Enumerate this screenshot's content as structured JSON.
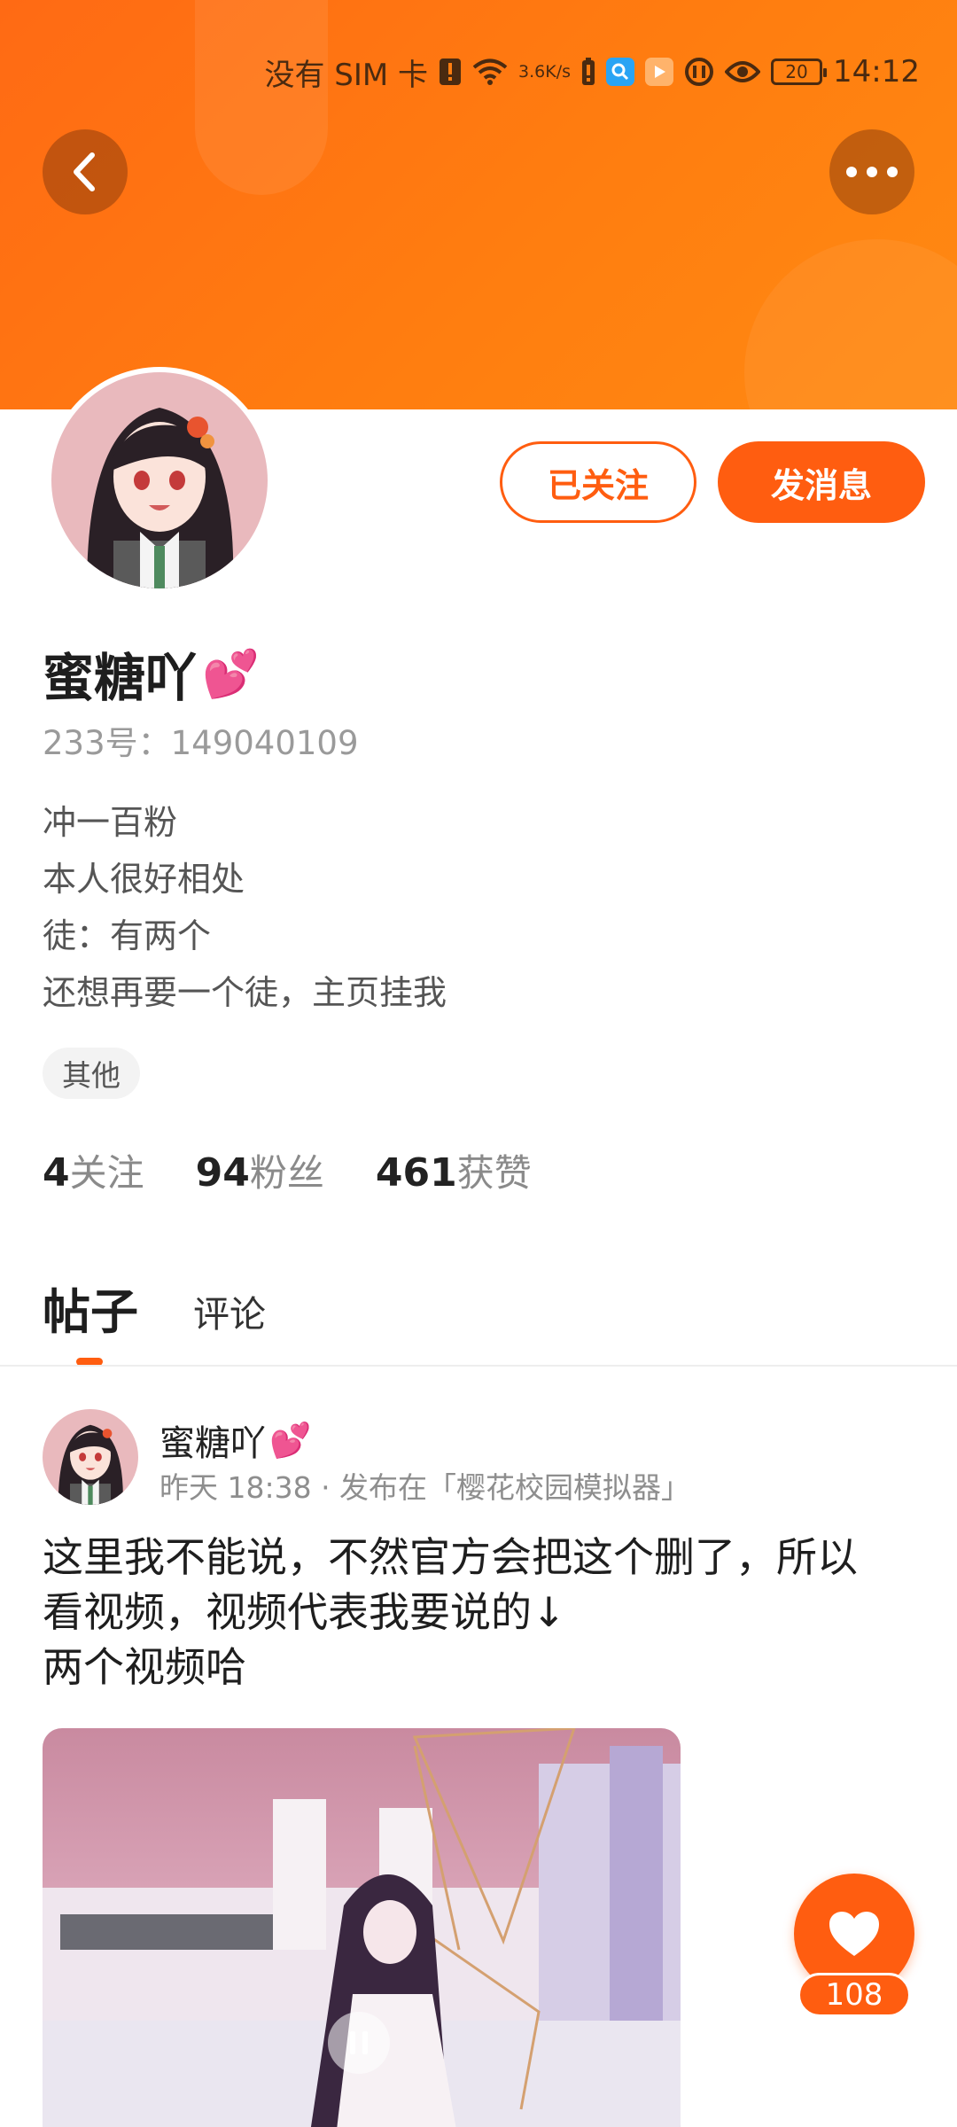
{
  "status_bar": {
    "carrier": "没有 SIM 卡",
    "speed_value": "3.6",
    "speed_unit": "K/s",
    "battery": "20",
    "time": "14:12"
  },
  "profile": {
    "name": "蜜糖吖",
    "name_emoji": "💕",
    "id_line": "233号：149040109",
    "bio": [
      "冲一百粉",
      "本人很好相处",
      "徒：有两个",
      "还想再要一个徒，主页挂我"
    ],
    "tag": "其他",
    "follow_button": "已关注",
    "message_button": "发消息"
  },
  "stats": [
    {
      "num": "4",
      "label": "关注"
    },
    {
      "num": "94",
      "label": "粉丝"
    },
    {
      "num": "461",
      "label": "获赞"
    }
  ],
  "tabs": [
    "帖子",
    "评论"
  ],
  "post": {
    "author": "蜜糖吖",
    "author_emoji": "💕",
    "meta": "昨天 18:38 · 发布在「樱花校园模拟器」",
    "text_lines": [
      "这里我不能说，不然官方会把这个删了，所以",
      "看视频，视频代表我要说的↓",
      "两个视频哈"
    ]
  },
  "like": {
    "count": "108"
  },
  "colors": {
    "accent": "#ff5d10",
    "header": "#ff7410"
  }
}
